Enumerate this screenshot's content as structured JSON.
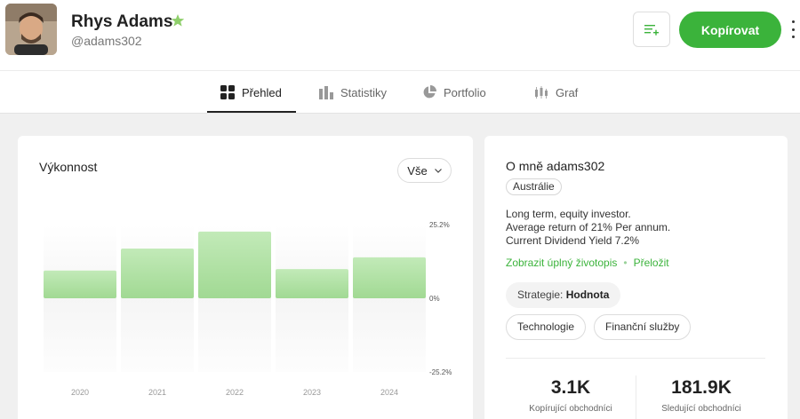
{
  "header": {
    "name": "Rhys Adams",
    "handle": "@adams302",
    "copy_label": "Kopírovat",
    "accent": "#3bb33b"
  },
  "tabs": [
    {
      "label": "Přehled",
      "icon": "grid-icon",
      "active": true
    },
    {
      "label": "Statistiky",
      "icon": "bar-chart-icon",
      "active": false
    },
    {
      "label": "Portfolio",
      "icon": "pie-chart-icon",
      "active": false
    },
    {
      "label": "Graf",
      "icon": "candlestick-icon",
      "active": false
    }
  ],
  "performance": {
    "title": "Výkonnost",
    "filter_label": "Vše"
  },
  "chart_data": {
    "type": "bar",
    "categories": [
      "2020",
      "2021",
      "2022",
      "2023",
      "2024"
    ],
    "values": [
      9.5,
      17.0,
      22.8,
      10.0,
      14.0
    ],
    "ylim": [
      -25.2,
      25.2
    ],
    "y_ticks": [
      "25.2%",
      "0%",
      "-25.2%"
    ],
    "bar_color": "#a8df9d",
    "grid": false
  },
  "about": {
    "title": "O mně adams302",
    "country": "Austrálie",
    "bio": [
      "Long term, equity investor.",
      "Average return of 21% Per annum.",
      "Current Dividend Yield 7.2%"
    ],
    "show_bio_label": "Zobrazit úplný životopis",
    "translate_label": "Přeložit",
    "strategy_prefix": "Strategie:",
    "strategy_value": "Hodnota",
    "tags": [
      "Technologie",
      "Finanční služby"
    ],
    "stats": [
      {
        "value": "3.1K",
        "label": "Kopírující obchodníci"
      },
      {
        "value": "181.9K",
        "label": "Sledující obchodníci"
      }
    ]
  }
}
